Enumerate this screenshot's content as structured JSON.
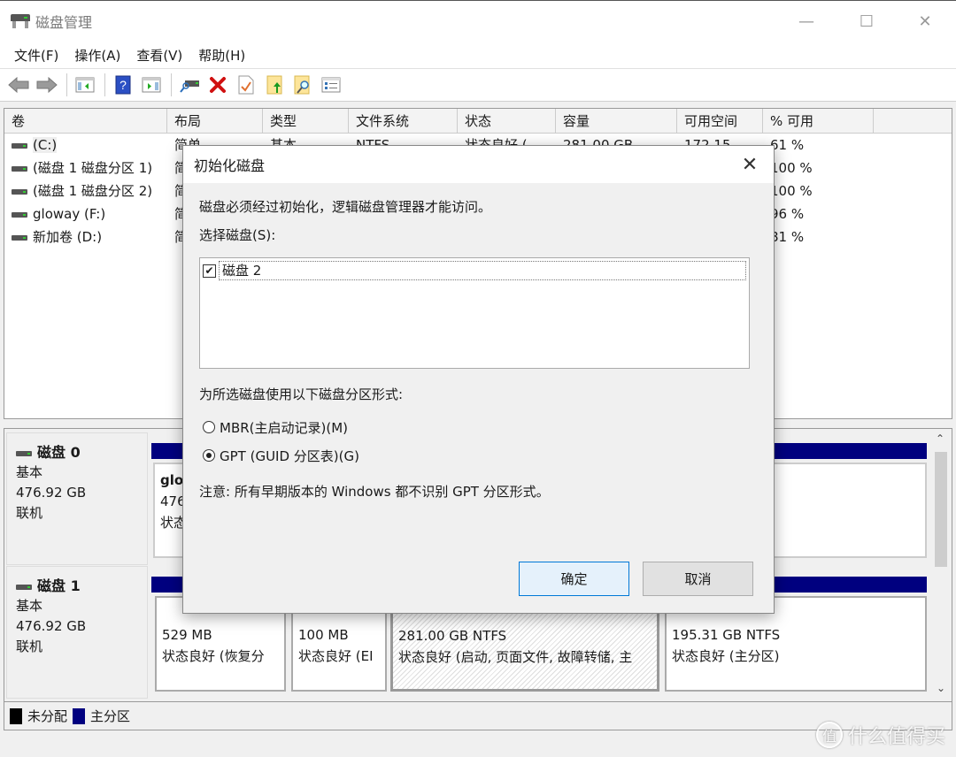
{
  "window": {
    "title": "磁盘管理",
    "controls": {
      "minimize": "—",
      "maximize": "☐",
      "close": "✕"
    }
  },
  "menu": [
    "文件(F)",
    "操作(A)",
    "查看(V)",
    "帮助(H)"
  ],
  "toolbar": {
    "icons": [
      "back-icon",
      "forward-icon",
      "show-hide-console-tree-icon",
      "help-icon",
      "show-hide-action-pane-icon",
      "connect-disk-icon",
      "delete-icon",
      "properties-icon",
      "export-list-icon",
      "find-icon",
      "settings-list-icon"
    ]
  },
  "volume_list": {
    "columns": [
      "卷",
      "布局",
      "类型",
      "文件系统",
      "状态",
      "容量",
      "可用空间",
      "% 可用"
    ],
    "rows": [
      {
        "volume": "(C:)",
        "layout": "简单",
        "type": "基本",
        "fs": "NTFS",
        "status": "状态良好 (",
        "capacity": "281.00 GB",
        "free": "172.15",
        "pct": "61 %"
      },
      {
        "volume": "(磁盘 1 磁盘分区 1)",
        "layout": "简",
        "type": "",
        "fs": "",
        "status": "",
        "capacity": "",
        "free": "",
        "pct": "100 %"
      },
      {
        "volume": "(磁盘 1 磁盘分区 2)",
        "layout": "简",
        "type": "",
        "fs": "",
        "status": "",
        "capacity": "",
        "free": "",
        "pct": "100 %"
      },
      {
        "volume": "gloway (F:)",
        "layout": "简",
        "type": "",
        "fs": "",
        "status": "",
        "capacity": "",
        "free": "",
        "pct": "96 %"
      },
      {
        "volume": "新加卷 (D:)",
        "layout": "简",
        "type": "",
        "fs": "",
        "status": "",
        "capacity": "",
        "free": "",
        "pct": "81 %"
      }
    ]
  },
  "disks": [
    {
      "name": "磁盘 0",
      "kind": "基本",
      "size": "476.92 GB",
      "state": "联机",
      "partitions": [
        {
          "name": "glo",
          "size": "476",
          "status": "状态"
        }
      ]
    },
    {
      "name": "磁盘 1",
      "kind": "基本",
      "size": "476.92 GB",
      "state": "联机",
      "partitions": [
        {
          "size": "529 MB",
          "status": "状态良好 (恢复分"
        },
        {
          "size": "100 MB",
          "status": "状态良好 (EI"
        },
        {
          "size": "281.00 GB NTFS",
          "status": "状态良好 (启动, 页面文件, 故障转储, 主"
        },
        {
          "size": "195.31 GB NTFS",
          "status": "状态良好 (主分区)"
        }
      ]
    }
  ],
  "legend": [
    {
      "label": "未分配",
      "color": "#000000"
    },
    {
      "label": "主分区",
      "color": "#00007f"
    }
  ],
  "dialog": {
    "title": "初始化磁盘",
    "message": "磁盘必须经过初始化，逻辑磁盘管理器才能访问。",
    "select_label": "选择磁盘(S):",
    "disks": [
      {
        "label": "磁盘 2",
        "checked": true
      }
    ],
    "style_label": "为所选磁盘使用以下磁盘分区形式:",
    "options": [
      {
        "label": "MBR(主启动记录)(M)",
        "selected": false
      },
      {
        "label": "GPT (GUID 分区表)(G)",
        "selected": true
      }
    ],
    "note": "注意: 所有早期版本的 Windows 都不识别 GPT 分区形式。",
    "ok": "确定",
    "cancel": "取消"
  },
  "watermark": {
    "badge": "值",
    "text": "什么值得买"
  }
}
